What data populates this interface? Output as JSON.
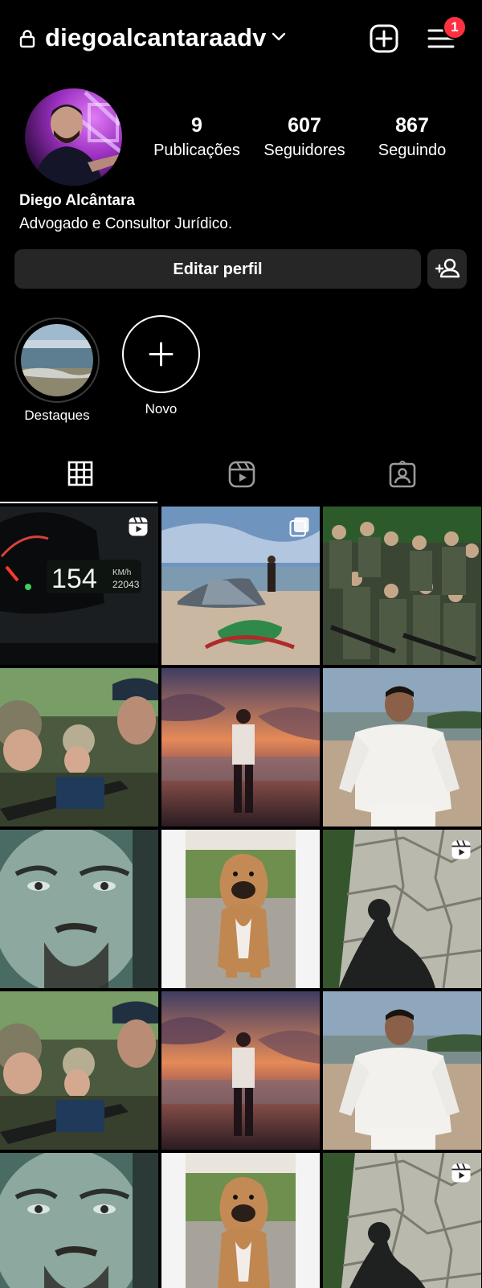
{
  "header": {
    "username": "diegoalcantaraadv",
    "notification_count": "1"
  },
  "profile": {
    "stats": [
      {
        "value": "9",
        "label": "Publicações"
      },
      {
        "value": "607",
        "label": "Seguidores"
      },
      {
        "value": "867",
        "label": "Seguindo"
      }
    ],
    "name": "Diego Alcântara",
    "bio": "Advogado e Consultor Jurídico.",
    "edit_button": "Editar perfil"
  },
  "highlights": [
    {
      "label": "Destaques"
    },
    {
      "label": "Novo"
    }
  ],
  "tabs": [
    "grid-icon",
    "reels-icon",
    "tagged-icon"
  ],
  "colors": {
    "background": "#000000",
    "button": "#262626",
    "badge": "#ff3040"
  },
  "grid": [
    {
      "name": "post-car-dashboard",
      "badge": "reels-icon"
    },
    {
      "name": "post-beach-kite",
      "badge": "carousel-icon"
    },
    {
      "name": "post-soldiers-group",
      "badge": ""
    },
    {
      "name": "post-soldiers-closeup",
      "badge": ""
    },
    {
      "name": "post-sunset-beach",
      "badge": ""
    },
    {
      "name": "post-man-white-shirt",
      "badge": ""
    },
    {
      "name": "post-face-closeup",
      "badge": ""
    },
    {
      "name": "post-dog",
      "badge": ""
    },
    {
      "name": "post-stone-shadow",
      "badge": "reels-icon"
    },
    {
      "name": "post-soldiers-closeup",
      "badge": ""
    },
    {
      "name": "post-sunset-beach",
      "badge": ""
    },
    {
      "name": "post-man-white-shirt",
      "badge": ""
    },
    {
      "name": "post-face-closeup",
      "badge": ""
    },
    {
      "name": "post-dog",
      "badge": ""
    },
    {
      "name": "post-stone-shadow",
      "badge": "reels-icon"
    }
  ]
}
